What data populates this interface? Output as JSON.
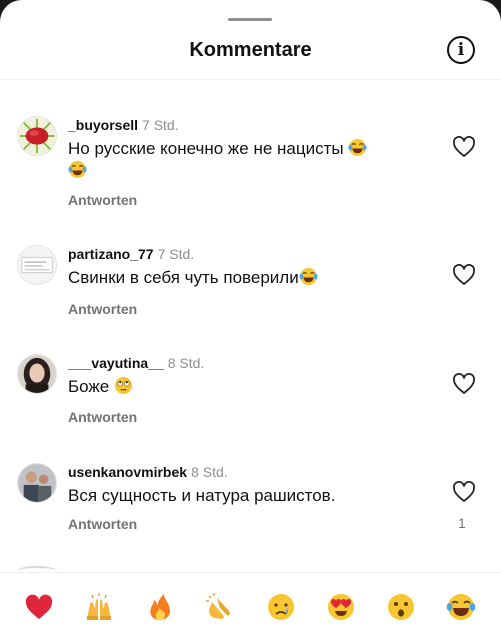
{
  "header": {
    "title": "Kommentare",
    "info_icon": "info-icon"
  },
  "comments": [
    {
      "username": "_buyorsell",
      "time": "7 Std.",
      "text": "Но русские конечно же не нацисты",
      "emoji": "face-with-tears-of-joy",
      "reply_label": "Antworten",
      "like_count": ""
    },
    {
      "username": "partizano_77",
      "time": "7 Std.",
      "text": "Свинки в себя чуть поверили",
      "emoji": "face-with-tears-of-joy",
      "reply_label": "Antworten",
      "like_count": ""
    },
    {
      "username": "___vayutina__",
      "time": "8 Std.",
      "text": "Боже",
      "emoji": "face-with-rolling-eyes",
      "reply_label": "Antworten",
      "like_count": ""
    },
    {
      "username": "usenkanovmirbek",
      "time": "8 Std.",
      "text": "Вся сущность и натура рашистов.",
      "emoji": "",
      "reply_label": "Antworten",
      "like_count": "1"
    }
  ],
  "reactions": [
    "red-heart",
    "raising-hands",
    "fire",
    "clapping-hands",
    "crying-face",
    "heart-eyes",
    "astonished-face",
    "face-with-tears-of-joy"
  ],
  "colors": {
    "muted_text": "#737373",
    "timestamp": "#8e8e8e",
    "divider": "#efefef"
  }
}
